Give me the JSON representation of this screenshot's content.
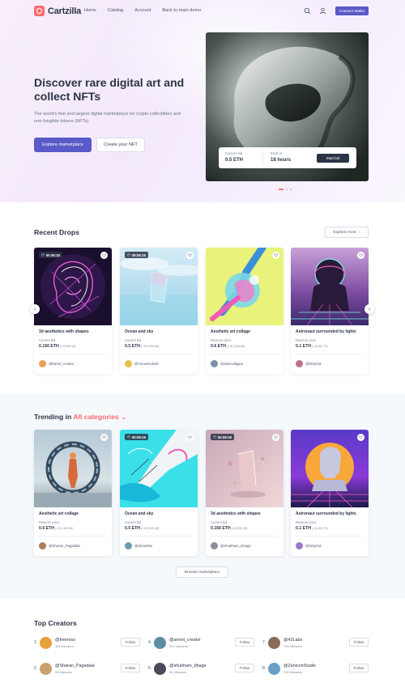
{
  "header": {
    "logo": "Cartzilla",
    "nav": [
      "Home",
      "Catalog",
      "Account",
      "Back to main demo"
    ],
    "search_icon": "search-icon",
    "account_icon": "user-icon",
    "connect_wallet": "Connect Wallet"
  },
  "hero": {
    "title": "Discover rare digital art and collect NFTs",
    "description": "The world's first and largest digital marketplace for crypto collectibles and non-fungible tokens (NFTs).",
    "explore_button": "Explore marketplace",
    "create_button": "Create your NFT",
    "current_bid_label": "Current bid",
    "current_bid_value": "0.5 ETH",
    "ends_in_label": "Ends in",
    "ends_in_value": "18 hours",
    "start_bid_button": "Start bid"
  },
  "recent_drops": {
    "title": "Recent Drops",
    "explore_more": "Explore more",
    "cards": [
      {
        "timer": "00:06:18",
        "title": "3d aesthetics with shapes",
        "label": "Current bid",
        "price": "0.156 ETH",
        "usd": "(≈ $ 595.15)",
        "owner": "@barret_creator",
        "avatar": "#e8a15a"
      },
      {
        "timer": "09:06:18",
        "title": "Ocean and sky",
        "label": "Current bid",
        "price": "0.5 ETH",
        "usd": "(≈ $ 2,000.65)",
        "owner": "@YunusKuleeb",
        "avatar": "#e6c34a"
      },
      {
        "timer": "",
        "title": "Aesthetic art collage",
        "label": "Reserve price",
        "price": "0.6 ETH",
        "usd": "(≈ $ 2,400.65)",
        "owner": "@aluscollages",
        "avatar": "#7a8fa8"
      },
      {
        "timer": "",
        "title": "Astronaut surrounded by lights",
        "label": "Reserve price",
        "price": "0.1 ETH",
        "usd": "(≈ $ 400.71)",
        "owner": "@DirtyKid",
        "avatar": "#c06e8a"
      }
    ]
  },
  "trending": {
    "title": "Trending in",
    "category": "All categories",
    "browse_button": "Browse marketplace",
    "cards": [
      {
        "timer": "",
        "title": "Aesthetic art collage",
        "label": "Reserve price",
        "price": "0.6 ETH",
        "usd": "(≈ $ 2,400.65)",
        "owner": "@Sharan_Pagadala",
        "avatar": "#b07a5a"
      },
      {
        "timer": "00:06:18",
        "title": "Ocean and sky",
        "label": "Current bid",
        "price": "0.5 ETH",
        "usd": "(≈ $ 2,000.65)",
        "owner": "@Simonlee",
        "avatar": "#6a9fb0"
      },
      {
        "timer": "00:06:18",
        "title": "3d aesthetics with shapes",
        "label": "Current bid",
        "price": "0.156 ETH",
        "usd": "(≈ $ 595.15)",
        "owner": "@Shubham_Dhage",
        "avatar": "#8a8f9c"
      },
      {
        "timer": "",
        "title": "Astronaut surrounded by lights",
        "label": "Reserve price",
        "price": "0.1 ETH",
        "usd": "(≈ $ 400.71)",
        "owner": "@DirtyKid",
        "avatar": "#9a7ac8"
      }
    ]
  },
  "top_creators": {
    "title": "Top Creators",
    "follow_label": "Follow",
    "creators": [
      {
        "num": "1.",
        "name": "@freeross",
        "followers": "1k9 followers",
        "avatar": "#e8a03a"
      },
      {
        "num": "4.",
        "name": "@annet_creator",
        "followers": "921 followers",
        "avatar": "#5a8fa0"
      },
      {
        "num": "7.",
        "name": "@42Labs",
        "followers": "735 followers",
        "avatar": "#8a6a5a"
      },
      {
        "num": "2.",
        "name": "@Sharan_Pagadala",
        "followers": "53 followers",
        "avatar": "#c9a070"
      },
      {
        "num": "5.",
        "name": "@shubham_dhage",
        "followers": "50 followers",
        "avatar": "#4a4a5a"
      },
      {
        "num": "8.",
        "name": "@ZeniconStudio",
        "followers": "728 followers",
        "avatar": "#6aa0c8"
      }
    ]
  },
  "colors": {
    "accent": "#5a5ac8",
    "brand": "#fe696a",
    "dark": "#2b3445"
  }
}
